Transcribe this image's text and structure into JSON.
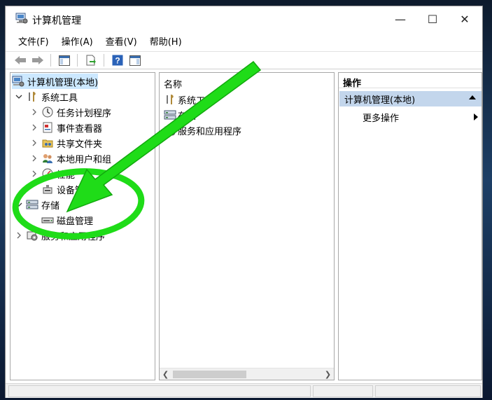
{
  "window": {
    "title": "计算机管理",
    "controls": {
      "minimize": "—",
      "maximize": "☐",
      "close": "✕"
    }
  },
  "menubar": {
    "items": [
      "文件(F)",
      "操作(A)",
      "查看(V)",
      "帮助(H)"
    ]
  },
  "toolbar": {
    "buttons": [
      "back-icon",
      "forward-icon",
      "show-hide-tree-icon",
      "export-list-icon",
      "help-icon",
      "show-action-pane-icon"
    ]
  },
  "tree": {
    "root": {
      "label": "计算机管理(本地)",
      "icon": "computer-management-icon"
    },
    "system_tools": {
      "label": "系统工具",
      "icon": "tools-icon",
      "children": [
        {
          "label": "任务计划程序",
          "icon": "clock-icon"
        },
        {
          "label": "事件查看器",
          "icon": "event-viewer-icon"
        },
        {
          "label": "共享文件夹",
          "icon": "shared-folder-icon"
        },
        {
          "label": "本地用户和组",
          "icon": "users-icon"
        },
        {
          "label": "性能",
          "icon": "performance-icon"
        },
        {
          "label": "设备管理器",
          "icon": "device-manager-icon"
        }
      ]
    },
    "storage": {
      "label": "存储",
      "icon": "storage-icon",
      "children": [
        {
          "label": "磁盘管理",
          "icon": "disk-icon"
        }
      ]
    },
    "services": {
      "label": "服务和应用程序",
      "icon": "services-icon"
    }
  },
  "list": {
    "header": "名称",
    "items": [
      {
        "label": "系统工具",
        "icon": "tools-icon"
      },
      {
        "label": "存储",
        "icon": "storage-icon"
      },
      {
        "label": "服务和应用程序",
        "icon": "services-icon"
      }
    ]
  },
  "actions": {
    "header": "操作",
    "section": "计算机管理(本地)",
    "items": [
      "更多操作"
    ]
  },
  "colors": {
    "annotation_green": "#1fdc18",
    "action_section_bg": "#c3d6ec"
  }
}
